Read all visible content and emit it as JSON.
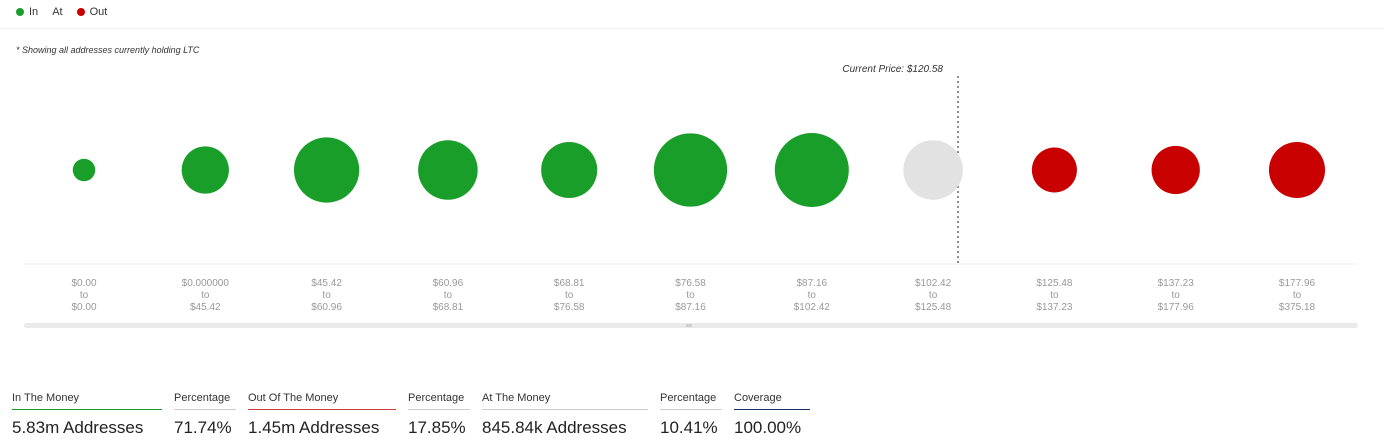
{
  "legend": [
    {
      "label": "In",
      "color": "#1a9e2a"
    },
    {
      "label": "At",
      "color": ""
    },
    {
      "label": "Out",
      "color": "#c80000"
    }
  ],
  "note": "* Showing all addresses currently holding LTC",
  "current_price_label": "Current Price: $120.58",
  "colors": {
    "in": "#1a9e2a",
    "at": "#e2e2e2",
    "out": "#c80000"
  },
  "chart_data": {
    "type": "bubble",
    "categories": [
      {
        "from": "$0.00",
        "to": "$0.00",
        "status": "in",
        "size": 0.5
      },
      {
        "from": "$0.000000",
        "to": "$45.42",
        "status": "in",
        "size": 2.2
      },
      {
        "from": "$45.42",
        "to": "$60.96",
        "status": "in",
        "size": 4.2
      },
      {
        "from": "$60.96",
        "to": "$68.81",
        "status": "in",
        "size": 3.5
      },
      {
        "from": "$68.81",
        "to": "$76.58",
        "status": "in",
        "size": 3.1
      },
      {
        "from": "$76.58",
        "to": "$87.16",
        "status": "in",
        "size": 5.3
      },
      {
        "from": "$87.16",
        "to": "$102.42",
        "status": "in",
        "size": 5.4
      },
      {
        "from": "$102.42",
        "to": "$125.48",
        "status": "at",
        "size": 3.5
      },
      {
        "from": "$125.48",
        "to": "$137.23",
        "status": "out",
        "size": 2.0
      },
      {
        "from": "$137.23",
        "to": "$177.96",
        "status": "out",
        "size": 2.3
      },
      {
        "from": "$177.96",
        "to": "$375.18",
        "status": "out",
        "size": 3.1
      }
    ]
  },
  "stats": [
    {
      "label": "In The Money",
      "value": "5.83m Addresses",
      "underline": "#1a9e2a",
      "width": 150
    },
    {
      "label": "Percentage",
      "value": "71.74%",
      "underline": "#cccccc",
      "width": 62
    },
    {
      "label": "Out Of The Money",
      "value": "1.45m Addresses",
      "underline": "#c84040",
      "width": 148
    },
    {
      "label": "Percentage",
      "value": "17.85%",
      "underline": "#cccccc",
      "width": 62
    },
    {
      "label": "At The Money",
      "value": "845.84k Addresses",
      "underline": "#cccccc",
      "width": 166
    },
    {
      "label": "Percentage",
      "value": "10.41%",
      "underline": "#cccccc",
      "width": 62
    },
    {
      "label": "Coverage",
      "value": "100.00%",
      "underline": "#1a2a6a",
      "width": 76
    }
  ]
}
